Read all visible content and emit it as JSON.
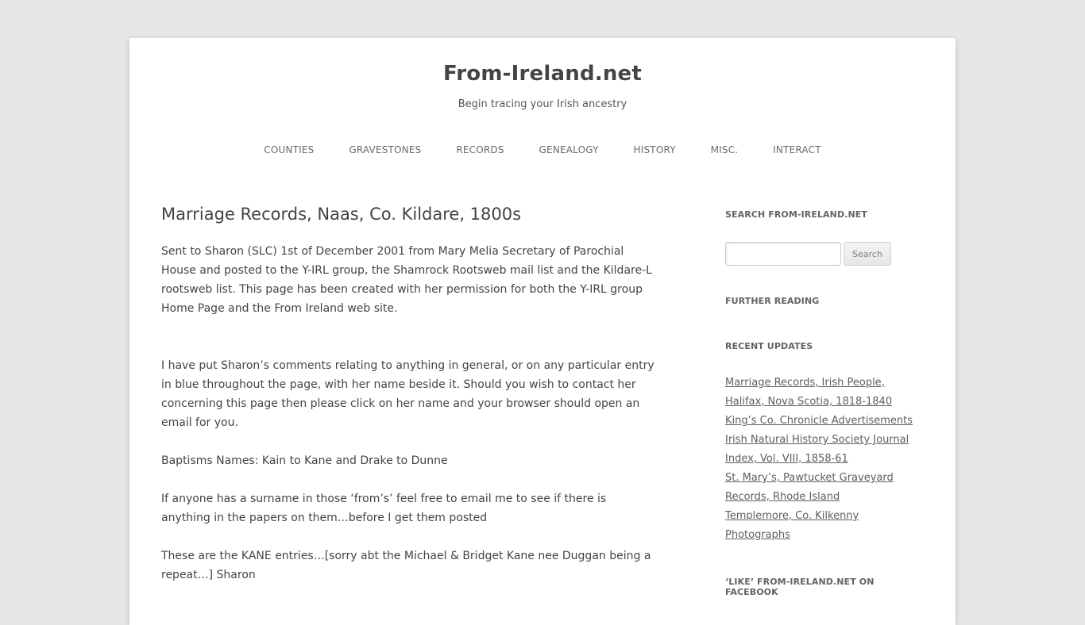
{
  "site": {
    "title": "From-Ireland.net",
    "tagline": "Begin tracing your Irish ancestry"
  },
  "nav": {
    "items": [
      {
        "label": "COUNTIES"
      },
      {
        "label": "GRAVESTONES"
      },
      {
        "label": "RECORDS"
      },
      {
        "label": "GENEALOGY"
      },
      {
        "label": "HISTORY"
      },
      {
        "label": "MISC."
      },
      {
        "label": "INTERACT"
      }
    ]
  },
  "post": {
    "title": "Marriage Records, Naas, Co. Kildare, 1800s",
    "paragraphs": [
      "Sent to Sharon (SLC) 1st of December 2001 from Mary Melia Secretary of Parochial House and posted to the Y-IRL group, the Shamrock Rootsweb mail list and the Kildare-L rootsweb list. This page has been created with her permission for both the Y-IRL group Home Page and the From Ireland web site.",
      "I have put Sharon’s comments relating to anything in general, or on any particular entry in blue throughout the page, with her name beside it. Should you wish to contact her concerning this page then please click on her name and your browser should open an email for you.",
      "Baptisms Names: Kain to Kane and Drake to Dunne",
      "If anyone has a surname in those ‘from’s’ feel free to email me to see if there is anything in the papers on them…before I get them posted",
      "These are the KANE entries…[sorry abt the Michael & Bridget Kane nee Duggan being a repeat…] Sharon"
    ]
  },
  "sidebar": {
    "search_title": "SEARCH FROM-IRELAND.NET",
    "search_value": "",
    "search_button": "Search",
    "further_title": "FURTHER READING",
    "recent_title": "RECENT UPDATES",
    "recent": [
      {
        "label": "Marriage Records, Irish People, Halifax, Nova Scotia, 1818-1840"
      },
      {
        "label": "King’s Co. Chronicle Advertisements"
      },
      {
        "label": "Irish Natural History Society Journal Index, Vol. VIII, 1858-61"
      },
      {
        "label": "St. Mary’s, Pawtucket Graveyard Records, Rhode Island"
      },
      {
        "label": "Templemore, Co. Kilkenny Photographs"
      }
    ],
    "facebook_title": "‘LIKE’ FROM-IRELAND.NET ON FACEBOOK"
  },
  "colors": {
    "background": "#e6e6e6",
    "page": "#ffffff",
    "text": "#444444",
    "link": "#5e5e5e"
  }
}
